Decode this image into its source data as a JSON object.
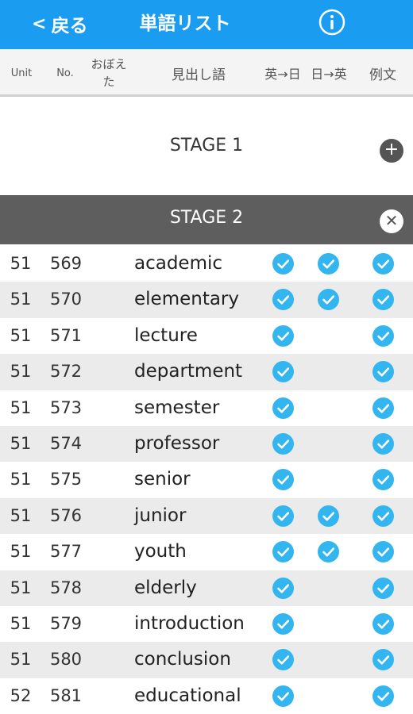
{
  "nav": {
    "back_label": "戻る",
    "title": "単語リスト"
  },
  "columns": {
    "unit": "Unit",
    "no": "No.",
    "memorized": "おぼえた",
    "headword": "見出し語",
    "en_ja": "英→日",
    "ja_en": "日→英",
    "example": "例文"
  },
  "stage1": {
    "label": "STAGE 1",
    "collapsed": true
  },
  "stage2": {
    "label": "STAGE 2",
    "collapsed": false
  },
  "colors": {
    "nav_bg": "#1a9cf0",
    "check": "#33b5f0",
    "stage2_bg": "#5e5e5e"
  },
  "words": [
    {
      "unit": "51",
      "no": "569",
      "word": "academic",
      "en_ja": true,
      "ja_en": true,
      "example": true
    },
    {
      "unit": "51",
      "no": "570",
      "word": "elementary",
      "en_ja": true,
      "ja_en": true,
      "example": true
    },
    {
      "unit": "51",
      "no": "571",
      "word": "lecture",
      "en_ja": true,
      "ja_en": false,
      "example": true
    },
    {
      "unit": "51",
      "no": "572",
      "word": "department",
      "en_ja": true,
      "ja_en": false,
      "example": true
    },
    {
      "unit": "51",
      "no": "573",
      "word": "semester",
      "en_ja": true,
      "ja_en": false,
      "example": true
    },
    {
      "unit": "51",
      "no": "574",
      "word": "professor",
      "en_ja": true,
      "ja_en": false,
      "example": true
    },
    {
      "unit": "51",
      "no": "575",
      "word": "senior",
      "en_ja": true,
      "ja_en": false,
      "example": true
    },
    {
      "unit": "51",
      "no": "576",
      "word": "junior",
      "en_ja": true,
      "ja_en": true,
      "example": true
    },
    {
      "unit": "51",
      "no": "577",
      "word": "youth",
      "en_ja": true,
      "ja_en": true,
      "example": true
    },
    {
      "unit": "51",
      "no": "578",
      "word": "elderly",
      "en_ja": true,
      "ja_en": false,
      "example": true
    },
    {
      "unit": "51",
      "no": "579",
      "word": "introduction",
      "en_ja": true,
      "ja_en": false,
      "example": true
    },
    {
      "unit": "51",
      "no": "580",
      "word": "conclusion",
      "en_ja": true,
      "ja_en": false,
      "example": true
    },
    {
      "unit": "52",
      "no": "581",
      "word": "educational",
      "en_ja": true,
      "ja_en": false,
      "example": true
    }
  ]
}
